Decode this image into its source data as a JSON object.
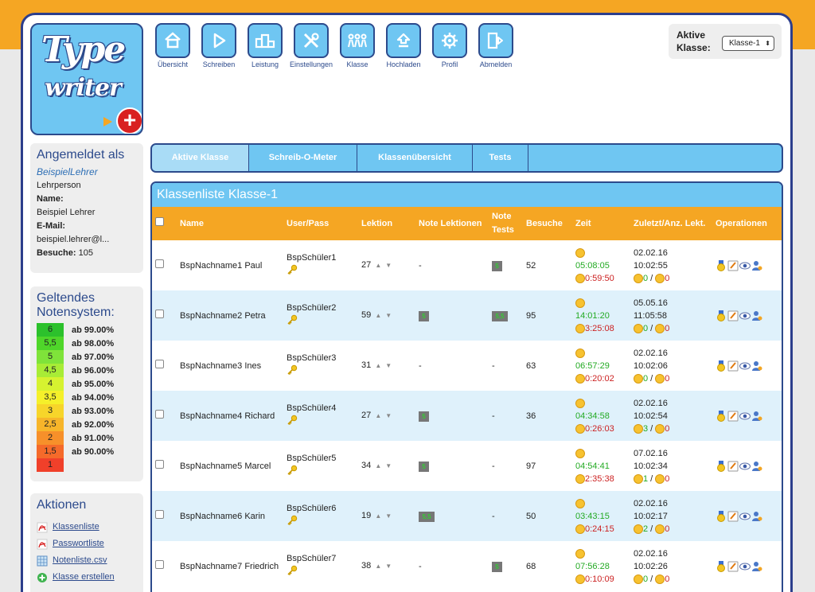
{
  "nav": [
    {
      "label": "Übersicht",
      "icon": "home-icon"
    },
    {
      "label": "Schreiben",
      "icon": "play-icon"
    },
    {
      "label": "Leistung",
      "icon": "podium-icon"
    },
    {
      "label": "Einstellungen",
      "icon": "tools-icon"
    },
    {
      "label": "Klasse",
      "icon": "people-icon"
    },
    {
      "label": "Hochladen",
      "icon": "upload-icon"
    },
    {
      "label": "Profil",
      "icon": "gear-icon"
    },
    {
      "label": "Abmelden",
      "icon": "logout-icon"
    }
  ],
  "logo": {
    "line1": "Type",
    "line2": "writer",
    "plus": "+"
  },
  "active_class": {
    "label_line1": "Aktive",
    "label_line2": "Klasse:",
    "selected": "Klasse-1",
    "arrow": "⬍"
  },
  "login": {
    "title": "Angemeldet als",
    "username": "BeispielLehrer",
    "role": "Lehrperson",
    "name_label": "Name:",
    "name": "Beispiel Lehrer",
    "email_label": "E-Mail:",
    "email": "beispiel.lehrer@l...",
    "visits_label": "Besuche:",
    "visits": "105"
  },
  "grading": {
    "title": "Geltendes Notensystem:",
    "rows": [
      {
        "grade": "6",
        "threshold": "ab 99.00%",
        "color": "#2cc12c"
      },
      {
        "grade": "5,5",
        "threshold": "ab 98.00%",
        "color": "#4fd62a"
      },
      {
        "grade": "5",
        "threshold": "ab 97.00%",
        "color": "#7fe33a"
      },
      {
        "grade": "4,5",
        "threshold": "ab 96.00%",
        "color": "#a8ec36"
      },
      {
        "grade": "4",
        "threshold": "ab 95.00%",
        "color": "#d6f230"
      },
      {
        "grade": "3,5",
        "threshold": "ab 94.00%",
        "color": "#f5f02a"
      },
      {
        "grade": "3",
        "threshold": "ab 93.00%",
        "color": "#f7d52a"
      },
      {
        "grade": "2,5",
        "threshold": "ab 92.00%",
        "color": "#f7b52a"
      },
      {
        "grade": "2",
        "threshold": "ab 91.00%",
        "color": "#f7902a"
      },
      {
        "grade": "1,5",
        "threshold": "ab 90.00%",
        "color": "#f56a2a"
      },
      {
        "grade": "1",
        "threshold": "",
        "color": "#f0402a"
      }
    ]
  },
  "actions": {
    "title": "Aktionen",
    "items": [
      {
        "label": "Klassenliste",
        "icon": "pdf-icon"
      },
      {
        "label": "Passwortliste",
        "icon": "pdf-icon"
      },
      {
        "label": "Notenliste.csv",
        "icon": "csv-icon"
      },
      {
        "label": "Klasse erstellen",
        "icon": "add-icon"
      }
    ]
  },
  "tabs": [
    {
      "label": "Aktive Klasse",
      "active": true
    },
    {
      "label": "Schreib-O-Meter",
      "active": false
    },
    {
      "label": "Klassenübersicht",
      "active": false
    },
    {
      "label": "Tests",
      "active": false
    }
  ],
  "classlist": {
    "title": "Klassenliste Klasse-1",
    "headers": {
      "name": "Name",
      "userpass": "User/Pass",
      "lektion": "Lektion",
      "note_lek": "Note Lektionen",
      "note_tests": "Note Tests",
      "besuche": "Besuche",
      "zeit": "Zeit",
      "zuletzt": "Zuletzt/Anz. Lekt.",
      "ops": "Operationen"
    },
    "rows": [
      {
        "name": "BspNachname1 Paul",
        "user": "BspSchüler1",
        "lektion": "27",
        "note_lek": "-",
        "note_tests": "5",
        "besuche": "52",
        "time_green": "05:08:05",
        "time_red": "0:59:50",
        "date": "02.02.16",
        "clock": "10:02:55",
        "count_green": "0",
        "count_red": "0"
      },
      {
        "name": "BspNachname2 Petra",
        "user": "BspSchüler2",
        "lektion": "59",
        "note_lek": "5",
        "note_tests": "5,5",
        "besuche": "95",
        "time_green": "14:01:20",
        "time_red": "3:25:08",
        "date": "05.05.16",
        "clock": "11:05:58",
        "count_green": "0",
        "count_red": "0"
      },
      {
        "name": "BspNachname3 Ines",
        "user": "BspSchüler3",
        "lektion": "31",
        "note_lek": "-",
        "note_tests": "-",
        "besuche": "63",
        "time_green": "06:57:29",
        "time_red": "0:20:02",
        "date": "02.02.16",
        "clock": "10:02:06",
        "count_green": "0",
        "count_red": "0"
      },
      {
        "name": "BspNachname4 Richard",
        "user": "BspSchüler4",
        "lektion": "27",
        "note_lek": "5",
        "note_tests": "-",
        "besuche": "36",
        "time_green": "04:34:58",
        "time_red": "0:26:03",
        "date": "02.02.16",
        "clock": "10:02:54",
        "count_green": "3",
        "count_red": "0"
      },
      {
        "name": "BspNachname5 Marcel",
        "user": "BspSchüler5",
        "lektion": "34",
        "note_lek": "5",
        "note_tests": "-",
        "besuche": "97",
        "time_green": "04:54:41",
        "time_red": "2:35:38",
        "date": "07.02.16",
        "clock": "10:02:34",
        "count_green": "1",
        "count_red": "0"
      },
      {
        "name": "BspNachname6 Karin",
        "user": "BspSchüler6",
        "lektion": "19",
        "note_lek": "5,5",
        "note_tests": "-",
        "besuche": "50",
        "time_green": "03:43:15",
        "time_red": "0:24:15",
        "date": "02.02.16",
        "clock": "10:02:17",
        "count_green": "2",
        "count_red": "0"
      },
      {
        "name": "BspNachname7 Friedrich",
        "user": "BspSchüler7",
        "lektion": "38",
        "note_lek": "-",
        "note_tests": "5",
        "besuche": "68",
        "time_green": "07:56:28",
        "time_red": "0:10:09",
        "date": "02.02.16",
        "clock": "10:02:26",
        "count_green": "0",
        "count_red": "0"
      }
    ]
  }
}
